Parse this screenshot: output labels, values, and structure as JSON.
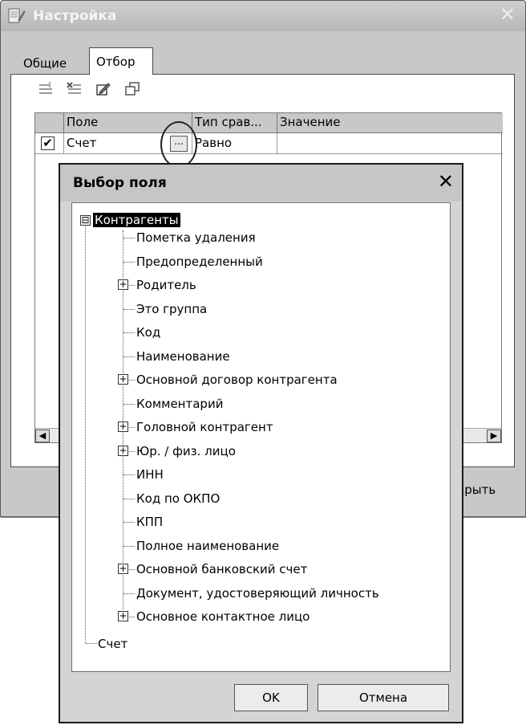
{
  "main_window": {
    "title": "Настройка",
    "tabs": [
      "Общие",
      "Отбор"
    ],
    "toolbar_icons": [
      "add-row-icon",
      "delete-row-icon",
      "edit-icon",
      "copy-icon"
    ],
    "grid": {
      "columns": [
        "Поле",
        "Тип срав...",
        "Значение"
      ],
      "rows": [
        {
          "checked": true,
          "check_mark": "✔",
          "field": "Счет",
          "ellipsis": "...",
          "comparison": "Равно",
          "value": ""
        }
      ]
    },
    "close_button_partial": "акрыть"
  },
  "dialog": {
    "title": "Выбор поля",
    "root": {
      "label": "Контрагенты",
      "expander": "⊟"
    },
    "items": [
      {
        "label": "Пометка удаления",
        "expandable": false
      },
      {
        "label": "Предопределенный",
        "expandable": false
      },
      {
        "label": "Родитель",
        "expandable": true
      },
      {
        "label": "Это группа",
        "expandable": false
      },
      {
        "label": "Код",
        "expandable": false
      },
      {
        "label": "Наименование",
        "expandable": false
      },
      {
        "label": "Основной договор контрагента",
        "expandable": true
      },
      {
        "label": "Комментарий",
        "expandable": false
      },
      {
        "label": "Головной контрагент",
        "expandable": true
      },
      {
        "label": "Юр. / физ. лицо",
        "expandable": true
      },
      {
        "label": "ИНН",
        "expandable": false
      },
      {
        "label": "Код по ОКПО",
        "expandable": false
      },
      {
        "label": "КПП",
        "expandable": false
      },
      {
        "label": "Полное наименование",
        "expandable": false
      },
      {
        "label": "Основной банковский счет",
        "expandable": true
      },
      {
        "label": "Документ, удостоверяющий личность",
        "expandable": false
      },
      {
        "label": "Основное контактное лицо",
        "expandable": true
      }
    ],
    "root2": {
      "label": "Счет"
    },
    "buttons": {
      "ok": "OK",
      "cancel": "Отмена"
    }
  }
}
